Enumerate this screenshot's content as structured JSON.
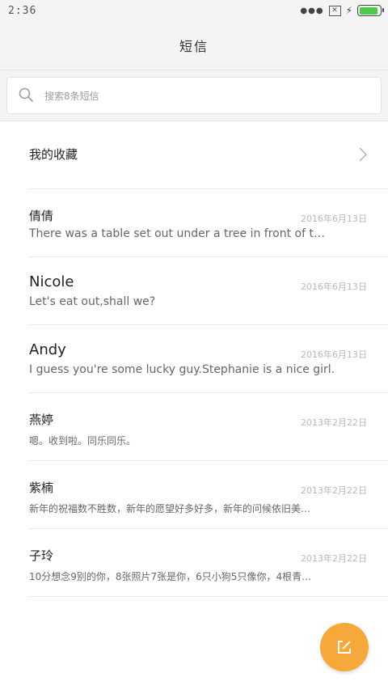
{
  "status_bar": {
    "time": "2:36"
  },
  "header": {
    "title": "短信"
  },
  "search": {
    "placeholder": "搜索8条短信"
  },
  "favorites": {
    "label": "我的收藏"
  },
  "messages": [
    {
      "name": "倩倩",
      "date": "2016年6月13日",
      "preview": "There was a table set out under a tree in front of t…"
    },
    {
      "name": "Nicole",
      "date": "2016年6月13日",
      "preview": "Let's eat out,shall we?"
    },
    {
      "name": "Andy",
      "date": "2016年6月13日",
      "preview": "I guess you're some lucky guy.Stephanie is a nice girl."
    },
    {
      "name": "燕婷",
      "date": "2013年2月22日",
      "preview": "嗯。收到啦。同乐同乐。"
    },
    {
      "name": "紫楠",
      "date": "2013年2月22日",
      "preview": "新年的祝福数不胜数，新年的愿望好多好多，新年的问候依旧美…"
    },
    {
      "name": "子玲",
      "date": "2013年2月22日",
      "preview": "10分想念9别的你，8张照片7张是你，6只小狗5只像你，4根青…"
    }
  ],
  "colors": {
    "fab": "#f7a83b",
    "battery": "#4cc84c"
  },
  "icons": {
    "search": "search-icon",
    "chevron": "chevron-right-icon",
    "compose": "compose-icon"
  }
}
